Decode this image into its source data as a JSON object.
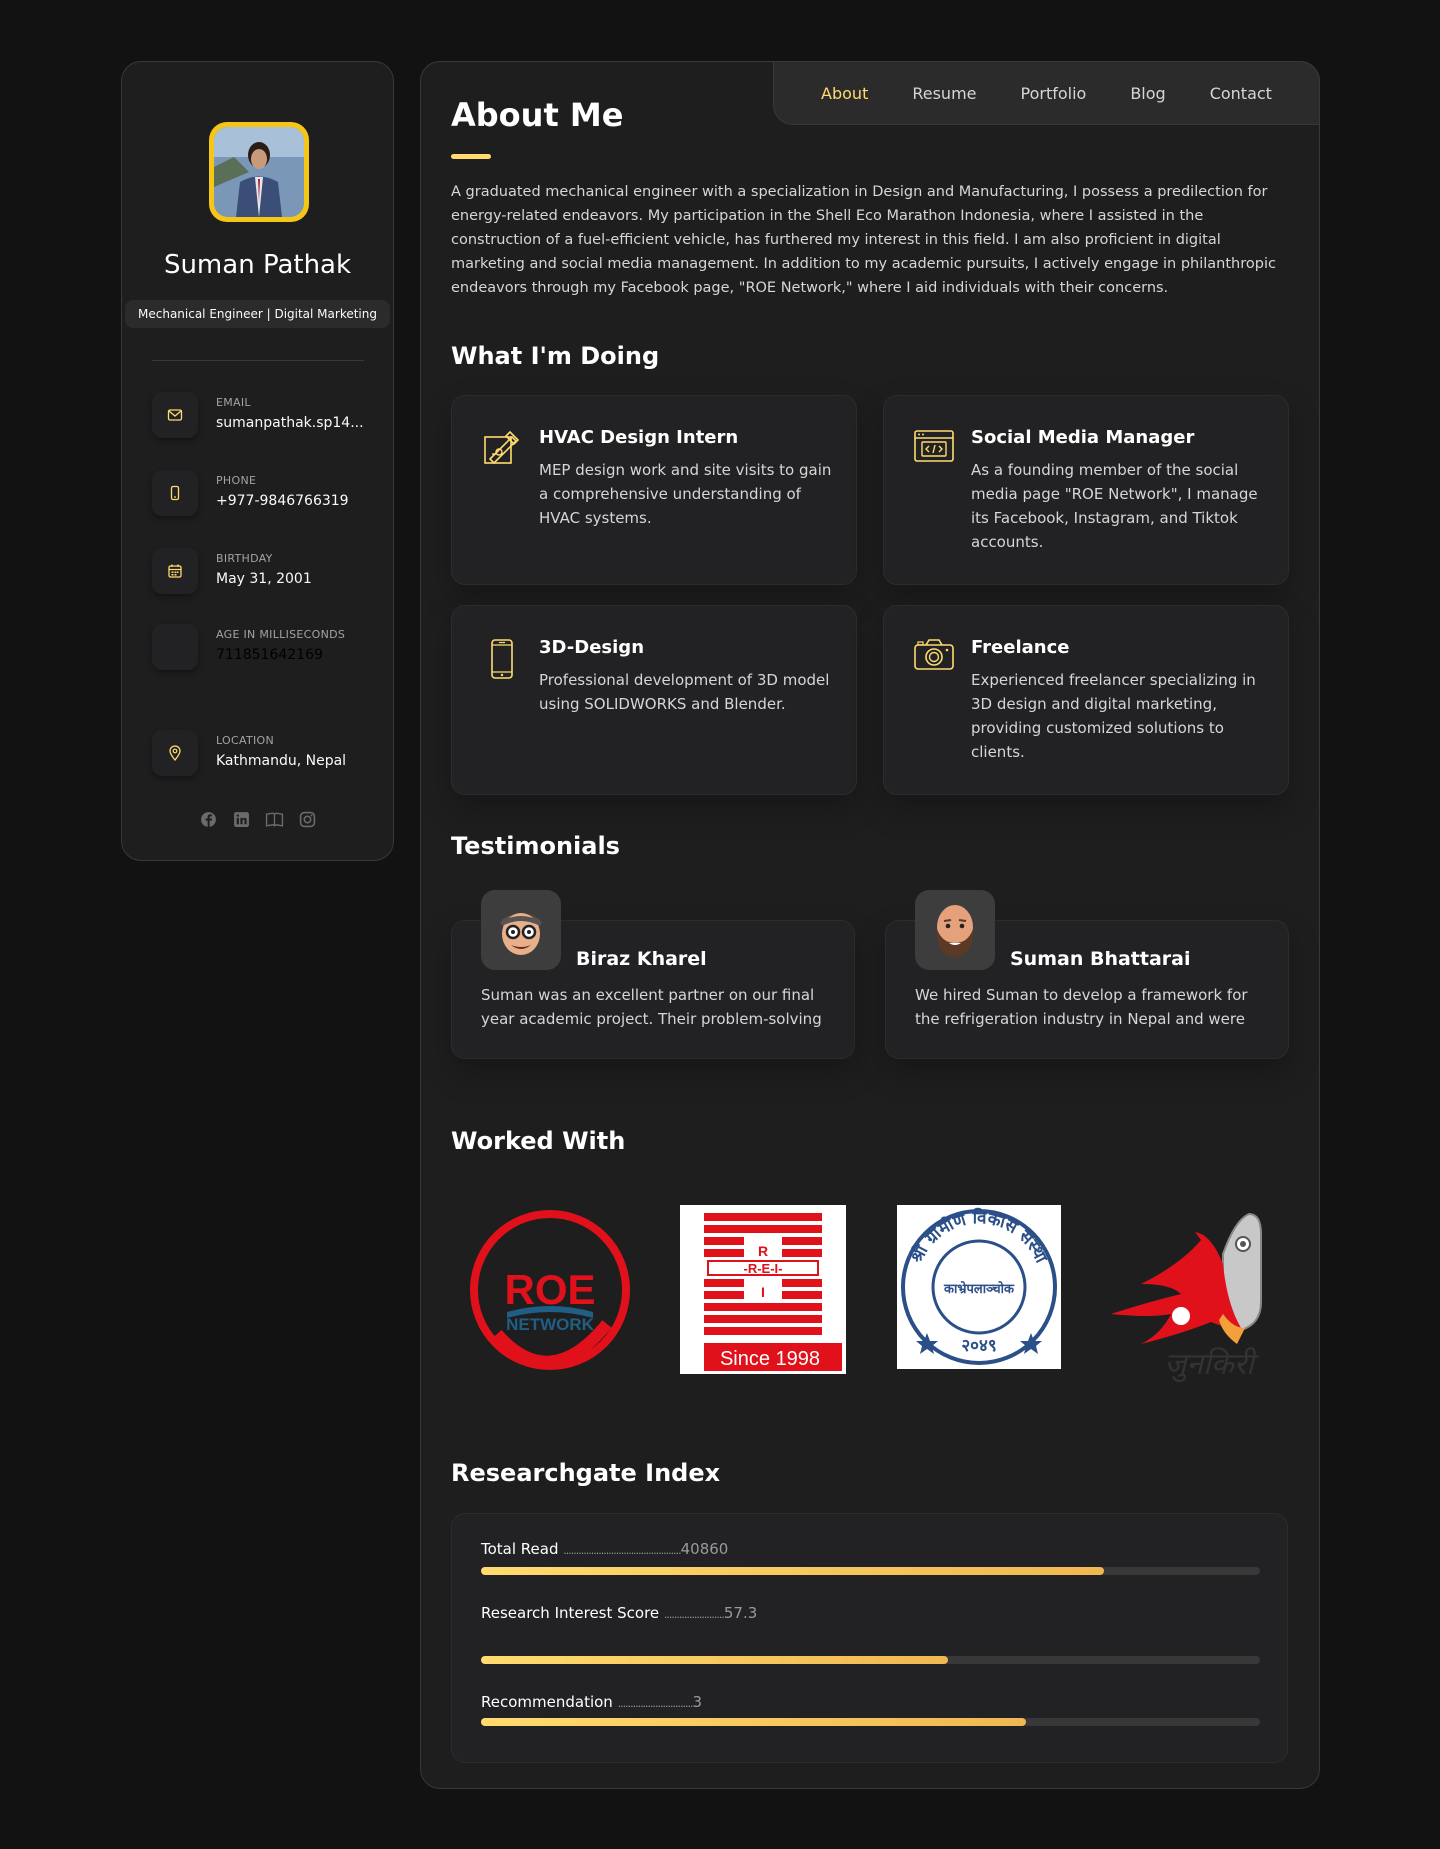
{
  "profile": {
    "name": "Suman Pathak",
    "title": "Mechanical Engineer | Digital Marketing"
  },
  "contacts": [
    {
      "label": "EMAIL",
      "value": "sumanpathak.sp14...",
      "icon": "mail-icon"
    },
    {
      "label": "PHONE",
      "value": "+977-9846766319",
      "icon": "phone-icon"
    },
    {
      "label": "BIRTHDAY",
      "value": "May 31, 2001",
      "icon": "calendar-icon"
    },
    {
      "label": "AGE IN MILLISECONDS",
      "value": "711851642169",
      "icon": ""
    },
    {
      "label": "LOCATION",
      "value": "Kathmandu, Nepal",
      "icon": "location-pin-icon"
    }
  ],
  "socials": [
    "facebook-icon",
    "linkedin-icon",
    "book-icon",
    "instagram-icon"
  ],
  "nav": [
    {
      "label": "About",
      "active": true
    },
    {
      "label": "Resume",
      "active": false
    },
    {
      "label": "Portfolio",
      "active": false
    },
    {
      "label": "Blog",
      "active": false
    },
    {
      "label": "Contact",
      "active": false
    }
  ],
  "about": {
    "heading": "About Me",
    "text": "A graduated mechanical engineer with a specialization in Design and Manufacturing, I possess a predilection for energy-related endeavors. My participation in the Shell Eco Marathon Indonesia, where I assisted in the construction of a fuel-efficient vehicle, has furthered my interest in this field. I am also proficient in digital marketing and social media management. In addition to my academic pursuits, I actively engage in philanthropic endeavors through my Facebook page, \"ROE Network,\" where I aid individuals with their concerns."
  },
  "services": {
    "heading": "What I'm Doing",
    "items": [
      {
        "title": "HVAC Design Intern",
        "text": "MEP design work and site visits to gain a comprehensive understanding of HVAC systems.",
        "icon": "design-tools-icon"
      },
      {
        "title": "Social Media Manager",
        "text": "As a founding member of the social media page \"ROE Network\", I manage its Facebook, Instagram, and Tiktok accounts.",
        "icon": "code-window-icon"
      },
      {
        "title": "3D-Design",
        "text": "Professional development of 3D model using SOLIDWORKS and Blender.",
        "icon": "mobile-device-icon"
      },
      {
        "title": "Freelance",
        "text": "Experienced freelancer specializing in 3D design and digital marketing, providing customized solutions to clients.",
        "icon": "camera-icon"
      }
    ]
  },
  "testimonials": {
    "heading": "Testimonials",
    "items": [
      {
        "name": "Biraz Kharel",
        "text": "Suman was an excellent partner on our final year academic project. Their problem-solving skills and dedication were outstanding."
      },
      {
        "name": "Suman Bhattarai",
        "text": "We hired Suman to develop a framework for the refrigeration industry in Nepal and were very satisfied with the result."
      }
    ]
  },
  "clients": {
    "heading": "Worked With",
    "logos": [
      {
        "name": "roe-network-logo",
        "line1": "ROE",
        "line2": "NETWORK"
      },
      {
        "name": "rei-logo",
        "line1": "R",
        "line2": "-R-E-I-",
        "line3": "I",
        "line4": "Since 1998"
      },
      {
        "name": "rural-development-seal",
        "line1": "श्री ग्रामीण विकास संस्था",
        "line2": "काभ्रेपलाञ्चोक",
        "line3": "२०४९"
      },
      {
        "name": "junkiri-logo",
        "line1": "जुनकिरी"
      }
    ]
  },
  "research": {
    "heading": "Researchgate Index",
    "items": [
      {
        "label": "Total Read",
        "dots": "...............................................",
        "value": "40860",
        "percent": 80
      },
      {
        "label": "Research Interest Score",
        "dots": "........................",
        "value": "57.3",
        "percent": 60
      },
      {
        "label": "Recommendation",
        "dots": "..............................",
        "value": "3",
        "percent": 70
      }
    ]
  },
  "colors": {
    "accent": "#ffdb70",
    "bg": "#121212",
    "card": "#1e1e1f"
  }
}
